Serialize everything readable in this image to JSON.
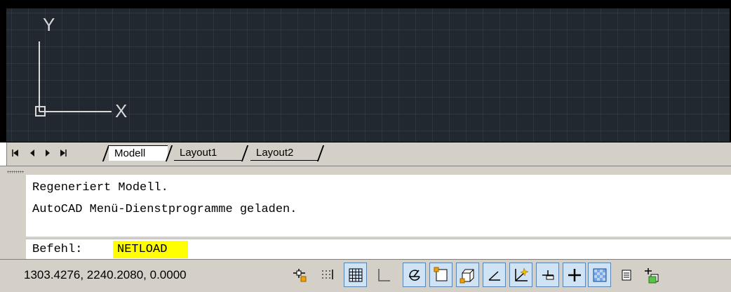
{
  "tabs": {
    "modell": "Modell",
    "layout1": "Layout1",
    "layout2": "Layout2"
  },
  "ucs": {
    "x_label": "X",
    "y_label": "Y"
  },
  "command_line": {
    "history": [
      "Regeneriert Modell.",
      "AutoCAD Menü-Dienstprogramme geladen."
    ],
    "prompt_label": "Befehl:",
    "prompt_value": "NETLOAD",
    "highlight_color": "#ffff00"
  },
  "status_bar": {
    "coordinates": "1303.4276, 2240.2080, 0.0000",
    "toggles": [
      {
        "name": "infer-constraints-icon",
        "on": false
      },
      {
        "name": "snap-mode-icon",
        "on": false
      },
      {
        "name": "grid-display-icon",
        "on": true
      },
      {
        "name": "ortho-mode-icon",
        "on": false
      },
      {
        "name": "polar-tracking-icon",
        "on": true
      },
      {
        "name": "object-snap-icon",
        "on": true
      },
      {
        "name": "3d-object-snap-icon",
        "on": true
      },
      {
        "name": "object-snap-tracking-icon",
        "on": true
      },
      {
        "name": "dynamic-ucs-icon",
        "on": true
      },
      {
        "name": "dynamic-input-icon",
        "on": true
      },
      {
        "name": "show-lineweight-icon",
        "on": true
      },
      {
        "name": "transparency-icon",
        "on": true
      },
      {
        "name": "quick-properties-icon",
        "on": false
      },
      {
        "name": "selection-cycling-icon",
        "on": false
      }
    ]
  },
  "colors": {
    "canvas_background": "#212830",
    "toggle_on": "#cfe3f5",
    "toggle_on_border": "#5a85b0"
  }
}
